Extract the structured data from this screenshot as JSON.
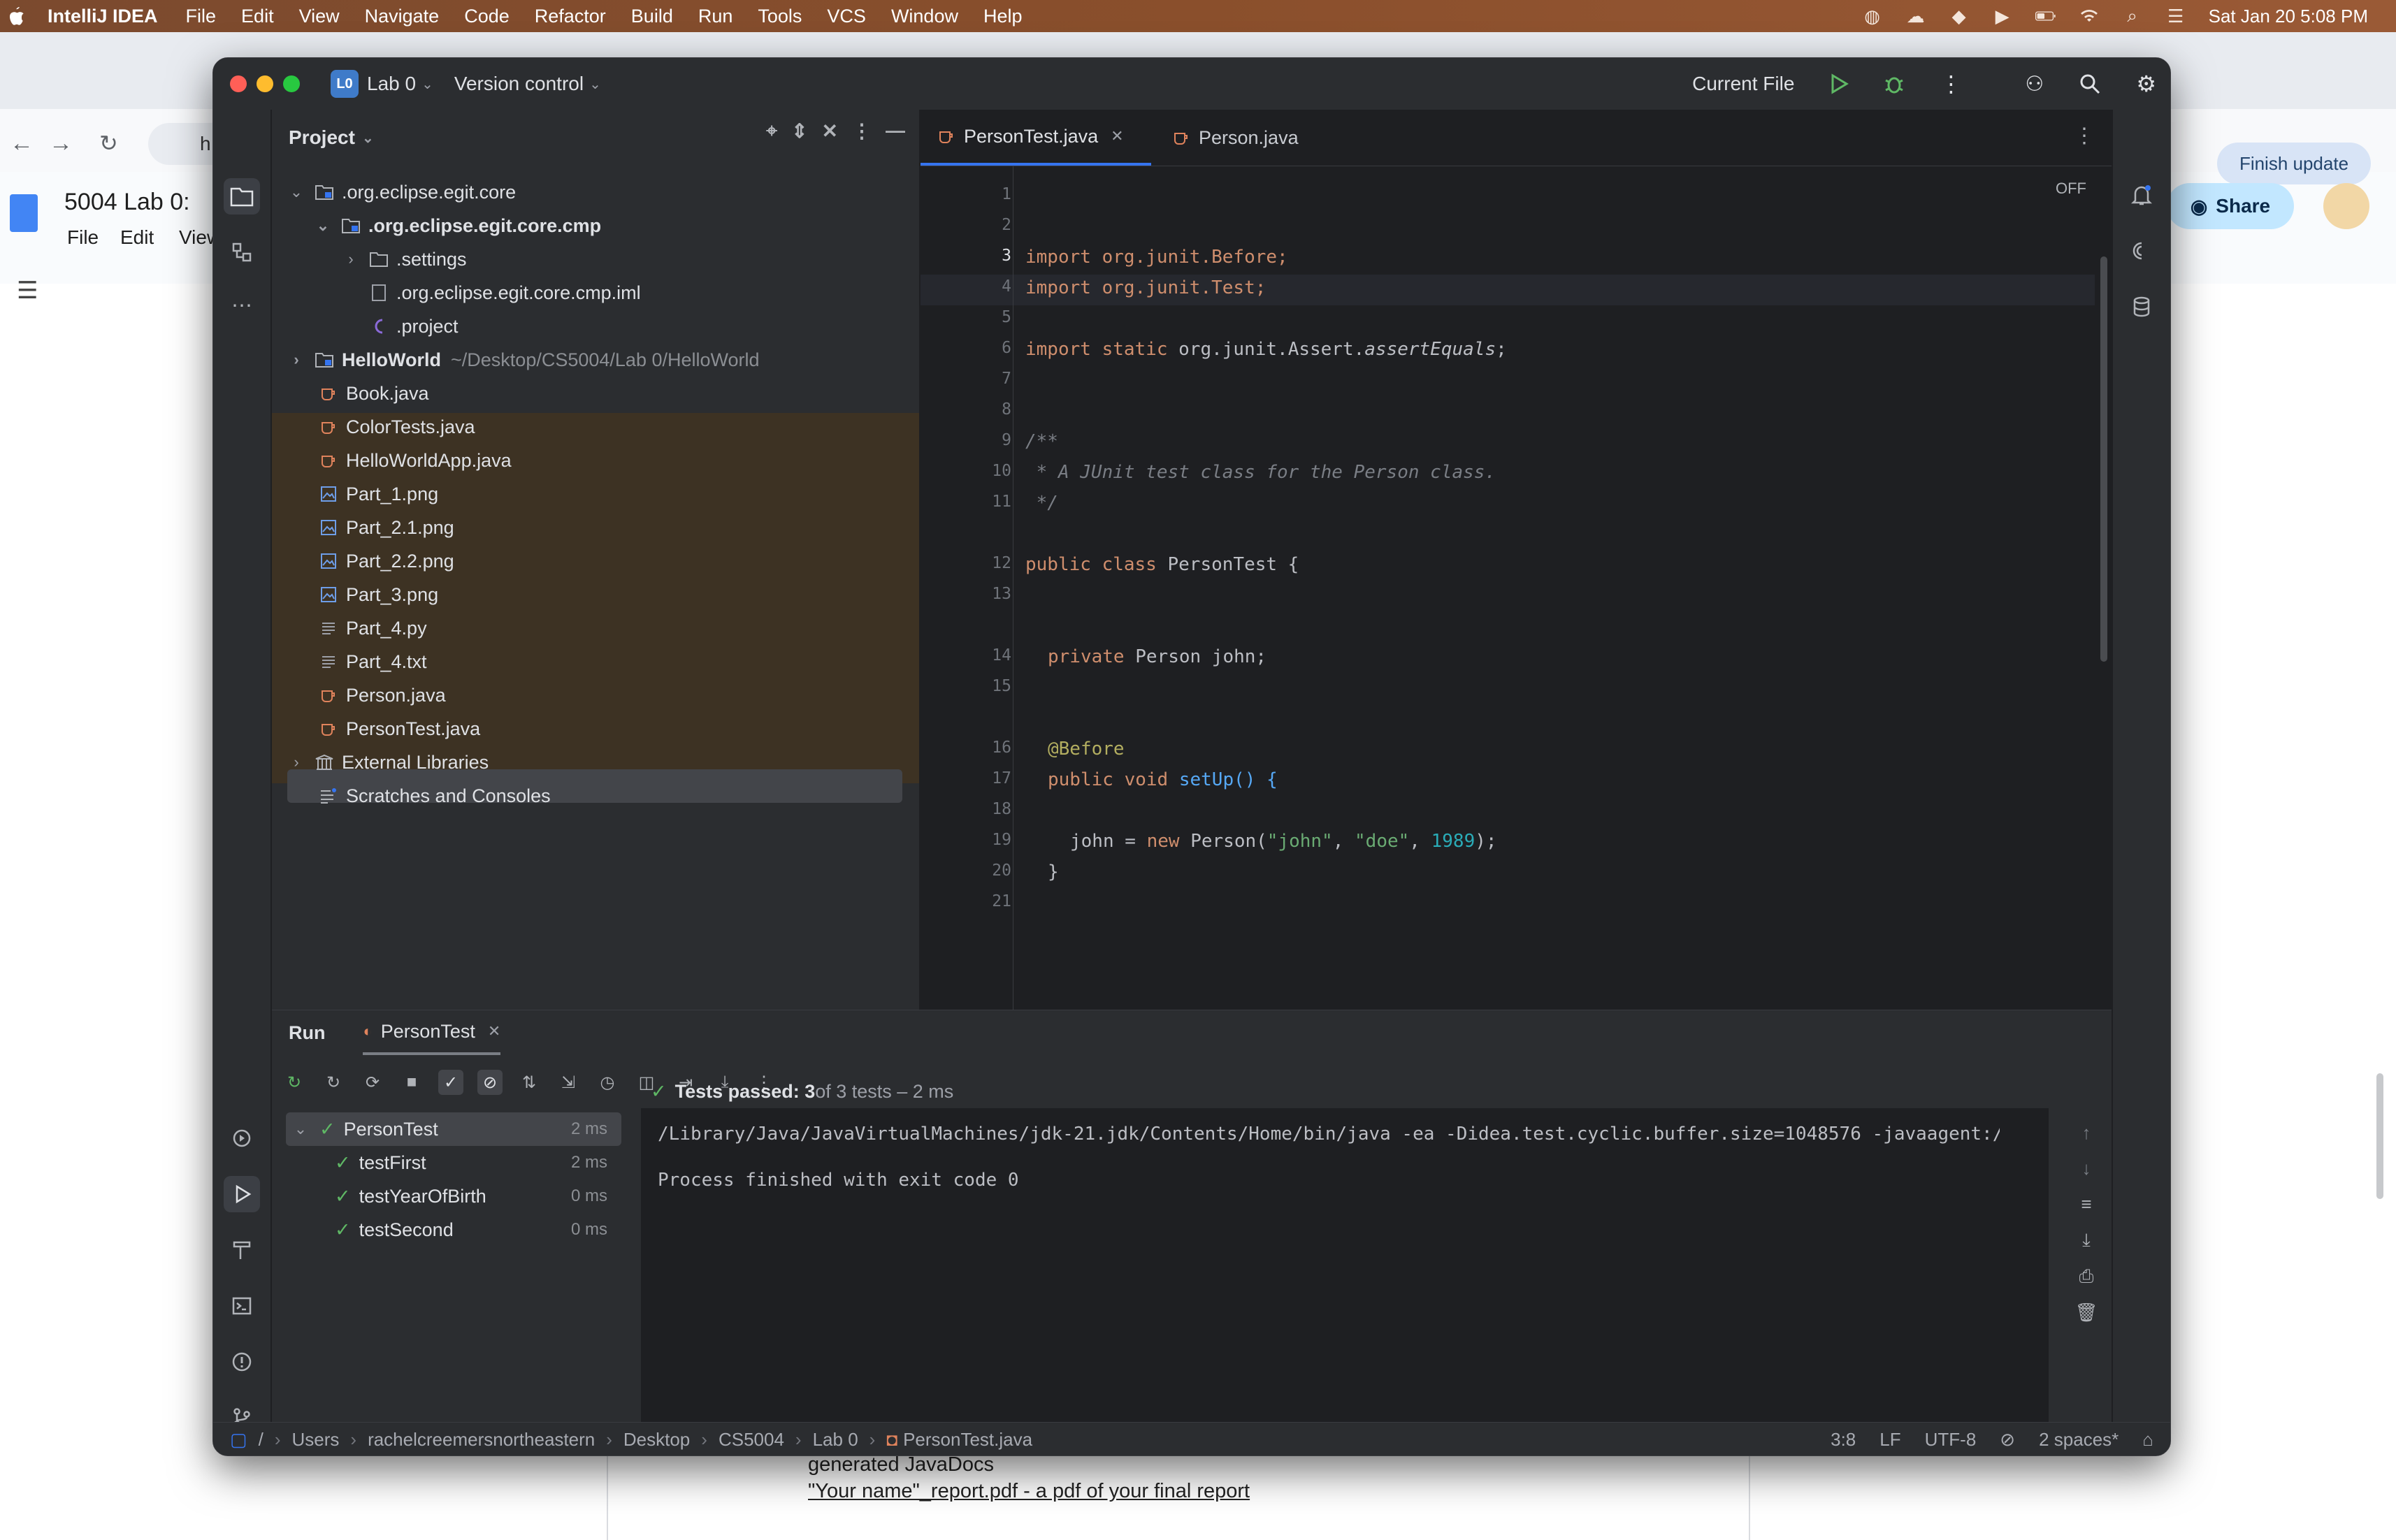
{
  "menubar": {
    "apple": "",
    "app_name": "IntelliJ IDEA",
    "items": [
      "File",
      "Edit",
      "View",
      "Navigate",
      "Code",
      "Refactor",
      "Build",
      "Run",
      "Tools",
      "VCS",
      "Window",
      "Help"
    ],
    "datetime": "Sat Jan 20  5:08 PM"
  },
  "background": {
    "doc_title": "5004 Lab 0:",
    "doc_menu": [
      "File",
      "Edit",
      "View"
    ],
    "addr_fragment": "h",
    "finish_update": "Finish update",
    "share": "Share",
    "doc_line1": "generated JavaDocs",
    "doc_line2": "\"Your name\"_report.pdf - a pdf of your final report"
  },
  "ide": {
    "project_badge": "L0",
    "project_name": "Lab 0",
    "vcs": "Version control",
    "run_config": "Current File",
    "project_panel_title": "Project",
    "tree": [
      {
        "label": ".org.eclipse.egit.core",
        "extra": ""
      },
      {
        "label": ".org.eclipse.egit.core.cmp",
        "extra": ""
      },
      {
        "label": ".settings",
        "extra": ""
      },
      {
        "label": ".org.eclipse.egit.core.cmp.iml",
        "extra": ""
      },
      {
        "label": ".project",
        "extra": ""
      },
      {
        "label": "HelloWorld",
        "extra": "~/Desktop/CS5004/Lab 0/HelloWorld"
      },
      {
        "label": "Book.java"
      },
      {
        "label": "ColorTests.java"
      },
      {
        "label": "HelloWorldApp.java"
      },
      {
        "label": "Part_1.png"
      },
      {
        "label": "Part_2.1.png"
      },
      {
        "label": "Part_2.2.png"
      },
      {
        "label": "Part_3.png"
      },
      {
        "label": "Part_4.py"
      },
      {
        "label": "Part_4.txt"
      },
      {
        "label": "Person.java"
      },
      {
        "label": "PersonTest.java"
      },
      {
        "label": "External Libraries"
      },
      {
        "label": "Scratches and Consoles"
      }
    ],
    "tabs": [
      "PersonTest.java",
      "Person.java"
    ],
    "readonly_flag": "OFF",
    "line_numbers": [
      "1",
      "2",
      "3",
      "4",
      "5",
      "6",
      "7",
      "8",
      "9",
      "10",
      "11",
      "12",
      "13",
      "14",
      "15",
      "16",
      "17",
      "18",
      "19",
      "20",
      "21"
    ],
    "code": {
      "l3": "import org.junit.Before;",
      "l4": "import org.junit.Test;",
      "l6a": "import static ",
      "l6b": "org.junit.Assert.",
      "l6c": "assertEquals",
      "l6d": ";",
      "l9": "/**",
      "l10": " * A JUnit test class for the Person class.",
      "l11": " */",
      "l12a": "public class ",
      "l12b": "PersonTest {",
      "l14a": "private ",
      "l14b": "Person john;",
      "l16": "@Before",
      "l17a": "public void ",
      "l17b": "setUp() {",
      "l19a": "john = ",
      "l19b": "new ",
      "l19c": "Person(",
      "l19d": "\"john\"",
      "l19e": ", ",
      "l19f": "\"doe\"",
      "l19g": ", ",
      "l19h": "1989",
      "l19i": ");",
      "l20": "}"
    },
    "run": {
      "tab_run": "Run",
      "tab_config": "PersonTest",
      "tests": [
        {
          "name": "PersonTest",
          "time": "2 ms"
        },
        {
          "name": "testFirst",
          "time": "2 ms"
        },
        {
          "name": "testYearOfBirth",
          "time": "0 ms"
        },
        {
          "name": "testSecond",
          "time": "0 ms"
        }
      ],
      "summary_bold": "Tests passed: 3",
      "summary_rest": " of 3 tests – 2 ms",
      "cmd": "/Library/Java/JavaVirtualMachines/jdk-21.jdk/Contents/Home/bin/java -ea -Didea.test.cyclic.buffer.size=1048576 -javaagent:/Applic",
      "exit": "Process finished with exit code 0"
    },
    "status": {
      "crumbs": [
        "Users",
        "rachelcreemersnortheastern",
        "Desktop",
        "CS5004",
        "Lab 0",
        "PersonTest.java"
      ],
      "root": "/",
      "position": "3:8",
      "line_sep": "LF",
      "encoding": "UTF-8",
      "indent": "2 spaces*"
    }
  },
  "colors": {
    "ide_bg": "#1e1f22",
    "panel_bg": "#2b2d30",
    "accent_blue": "#3574f0",
    "pass_green": "#5fb865",
    "keyword": "#cf8e6d"
  }
}
